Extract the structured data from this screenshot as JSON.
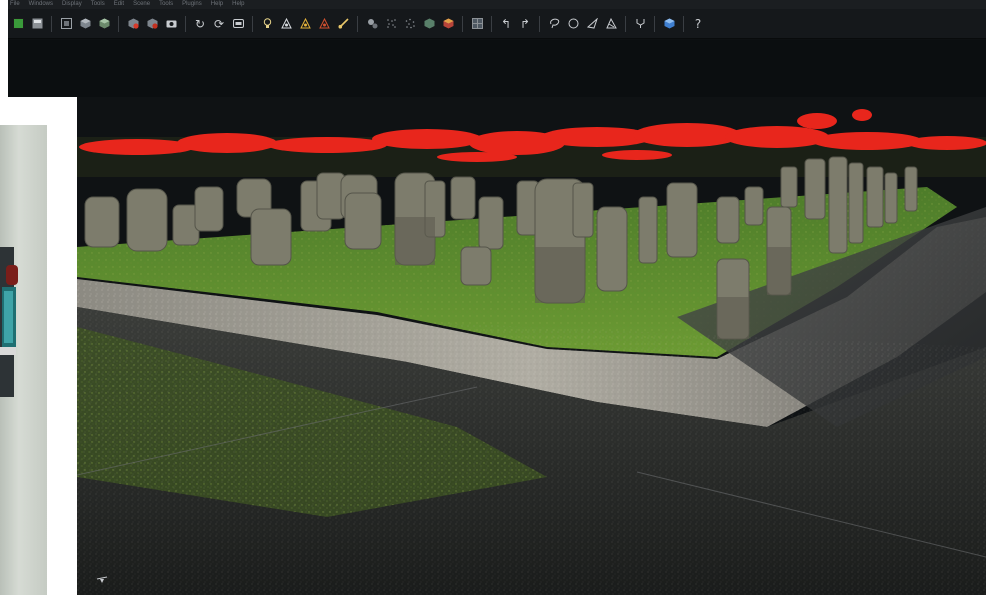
{
  "menu": [
    "File",
    "Windows",
    "Display",
    "Tools",
    "Edit",
    "Scene",
    "Tools",
    "Plugins",
    "Help",
    "Help"
  ],
  "toolbar": {
    "help_label": "?",
    "icons": [
      "new-icon",
      "save-icon",
      "sep",
      "snapshot-icon",
      "cube-icon",
      "cube-icon",
      "sep",
      "delete-icon",
      "delete-icon",
      "camera-icon",
      "sep",
      "rotate-left-icon",
      "rotate-icon",
      "viewport-icon",
      "sep",
      "light-icon",
      "triangle-icon",
      "triangle-icon",
      "triangle-icon",
      "brush-icon",
      "sep",
      "segment-icon",
      "scatter-icon",
      "scatter-icon",
      "octree-icon",
      "color-cube-icon",
      "sep",
      "mesh-icon",
      "sep",
      "undo-icon",
      "redo-icon",
      "sep",
      "lasso-icon",
      "circle-icon",
      "pick-icon",
      "plane-icon",
      "sep",
      "fork-icon",
      "sep",
      "box3d-icon",
      "sep",
      "help-icon"
    ]
  },
  "colors": {
    "app_bg": "#0d1012",
    "toolbar_bg": "#15181b",
    "grass": "#5b8a2e",
    "red_points": "#e8261c",
    "stone": "#7d7c6c",
    "path": "#a9a79d"
  }
}
